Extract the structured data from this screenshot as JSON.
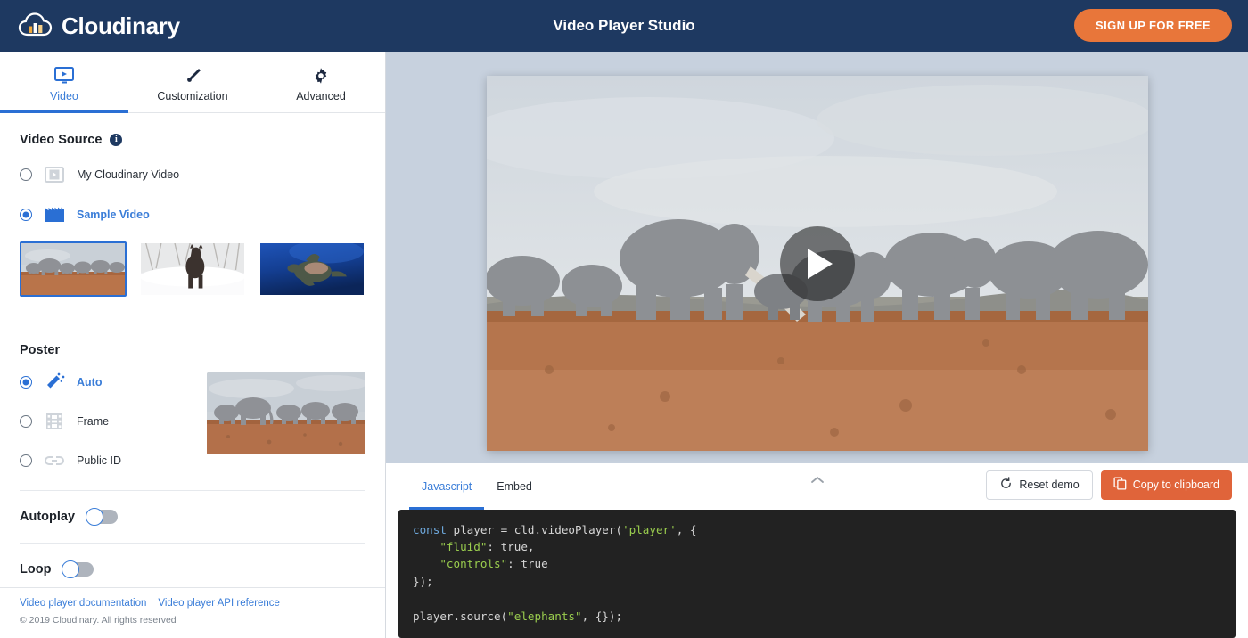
{
  "header": {
    "brand": "Cloudinary",
    "logo_icon": "cloudinary-cloud-logo",
    "title": "Video Player Studio",
    "signup_label": "SIGN UP FOR FREE",
    "bg_color": "#1e3961",
    "accent_color": "#e8763a"
  },
  "sidebar": {
    "tabs": [
      {
        "label": "Video",
        "icon": "video-monitor-icon",
        "active": true
      },
      {
        "label": "Customization",
        "icon": "paintbrush-icon",
        "active": false
      },
      {
        "label": "Advanced",
        "icon": "gear-icon",
        "active": false
      }
    ],
    "video_source": {
      "title": "Video Source",
      "info_icon": "info-icon",
      "options": [
        {
          "label": "My Cloudinary Video",
          "icon": "video-frame-icon",
          "selected": false
        },
        {
          "label": "Sample Video",
          "icon": "clapperboard-icon",
          "selected": true
        }
      ],
      "samples": [
        {
          "name": "elephants",
          "selected": true
        },
        {
          "name": "horse-in-snow",
          "selected": false
        },
        {
          "name": "sea-turtle",
          "selected": false
        }
      ]
    },
    "poster": {
      "title": "Poster",
      "options": [
        {
          "label": "Auto",
          "icon": "magic-wand-icon",
          "selected": true
        },
        {
          "label": "Frame",
          "icon": "film-strip-icon",
          "selected": false
        },
        {
          "label": "Public ID",
          "icon": "link-icon",
          "selected": false
        }
      ],
      "preview_name": "elephants-poster"
    },
    "autoplay": {
      "label": "Autoplay",
      "on": false
    },
    "loop": {
      "label": "Loop",
      "on": false
    },
    "footer": {
      "links": [
        {
          "label": "Video player documentation"
        },
        {
          "label": "Video player API reference"
        }
      ],
      "copyright": "© 2019 Cloudinary. All rights reserved"
    }
  },
  "main": {
    "stage_bg": "#c7d1de",
    "player": {
      "poster_name": "elephants-video-poster",
      "play_icon": "play-triangle-icon"
    },
    "code_panel": {
      "tabs": [
        {
          "label": "Javascript",
          "active": true
        },
        {
          "label": "Embed",
          "active": false
        }
      ],
      "collapse_icon": "chevron-up-icon",
      "reset_label": "Reset demo",
      "reset_icon": "refresh-ccw-icon",
      "copy_label": "Copy to clipboard",
      "copy_icon": "copy-icon",
      "code_lines": [
        {
          "parts": [
            {
              "t": "const ",
              "c": "kw"
            },
            {
              "t": "player = cld.videoPlayer(",
              "c": "plain"
            },
            {
              "t": "'player'",
              "c": "str"
            },
            {
              "t": ", {",
              "c": "plain"
            }
          ]
        },
        {
          "parts": [
            {
              "t": "    ",
              "c": "plain"
            },
            {
              "t": "\"fluid\"",
              "c": "str"
            },
            {
              "t": ": true,",
              "c": "plain"
            }
          ]
        },
        {
          "parts": [
            {
              "t": "    ",
              "c": "plain"
            },
            {
              "t": "\"controls\"",
              "c": "str"
            },
            {
              "t": ": true",
              "c": "plain"
            }
          ]
        },
        {
          "parts": [
            {
              "t": "});",
              "c": "plain"
            }
          ]
        },
        {
          "parts": [
            {
              "t": "",
              "c": "plain"
            }
          ]
        },
        {
          "parts": [
            {
              "t": "player.source(",
              "c": "plain"
            },
            {
              "t": "\"elephants\"",
              "c": "str"
            },
            {
              "t": ", {});",
              "c": "plain"
            }
          ]
        }
      ]
    }
  }
}
